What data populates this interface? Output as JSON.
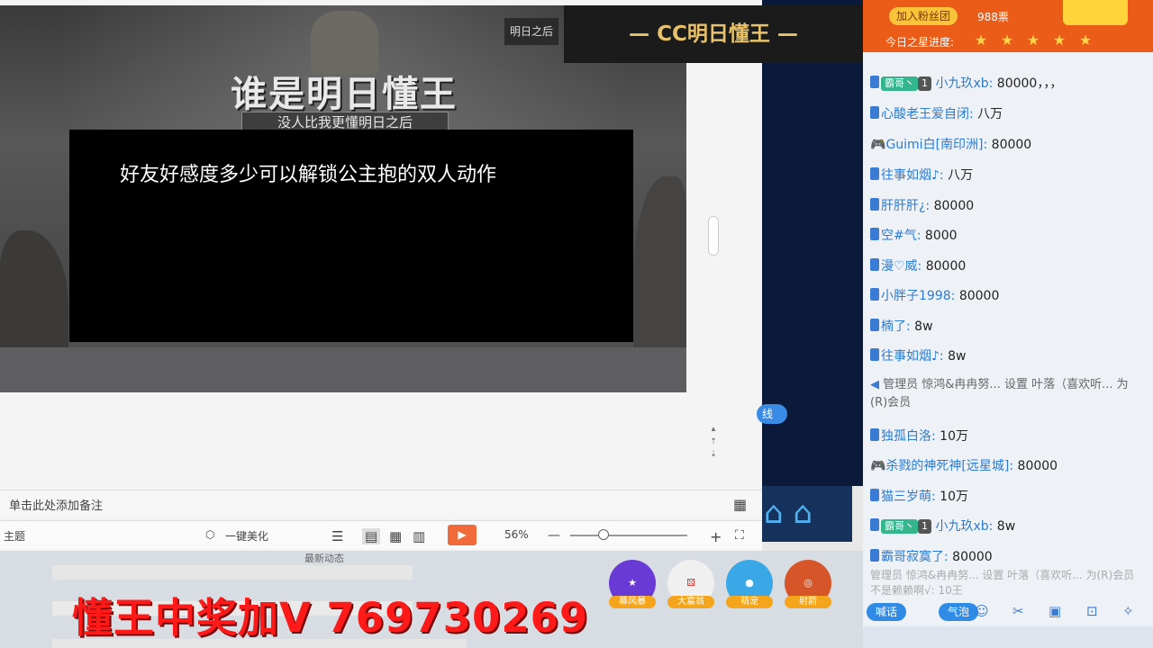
{
  "slide": {
    "logo": "明日之后",
    "title": "谁是明日懂王",
    "subtitle": "没人比我更懂明日之后",
    "question": "好友好感度多少可以解锁公主抱的双人动作"
  },
  "notes": {
    "placeholder": "单击此处添加备注"
  },
  "statusbar": {
    "theme": "主题",
    "beautify": "一键美化",
    "zoom": "56%"
  },
  "banner": {
    "text": "CC明日懂王"
  },
  "live_tag": "线",
  "feed": {
    "title": "最新动态",
    "promo": "懂王中奖加V 769730269"
  },
  "gifts": [
    {
      "label": "幕风暴"
    },
    {
      "label": "大富翁"
    },
    {
      "label": "萌宠"
    },
    {
      "label": "射箭"
    }
  ],
  "panel": {
    "join_fans": "加入粉丝团",
    "votes": "988票",
    "star_progress_label": "今日之星进度:",
    "stars": [
      "1",
      "2",
      "3",
      "4",
      "5"
    ]
  },
  "chat": [
    {
      "badge": "霸哥丶",
      "level": "1",
      "user": "小九玖xb:",
      "msg": "80000，，，"
    },
    {
      "badge": "",
      "level": "",
      "user": "心酸老王爱自闭:",
      "msg": "八万"
    },
    {
      "badge": "",
      "level": "",
      "user": "Guimi白[南印洲]:",
      "msg": "80000"
    },
    {
      "badge": "",
      "level": "",
      "user": "往事如烟♪:",
      "msg": "八万"
    },
    {
      "badge": "",
      "level": "",
      "user": "肝肝肝¿:",
      "msg": "80000"
    },
    {
      "badge": "",
      "level": "",
      "user": "空#气:",
      "msg": "8000"
    },
    {
      "badge": "",
      "level": "",
      "user": "漫♡威:",
      "msg": "80000"
    },
    {
      "badge": "",
      "level": "",
      "user": "小胖子1998:",
      "msg": "80000"
    },
    {
      "badge": "",
      "level": "",
      "user": "楠了:",
      "msg": "8w"
    },
    {
      "badge": "",
      "level": "",
      "user": "往事如烟♪:",
      "msg": "8w"
    }
  ],
  "system_msg": "管理员  惊鸿&冉冉努...  设置  叶落（喜欢听... 为(R)会员",
  "chat2": [
    {
      "badge": "",
      "level": "",
      "user": "独孤白洛:",
      "msg": "10万"
    },
    {
      "badge": "",
      "level": "",
      "user": "杀戮的神死神[远星城]:",
      "msg": "80000"
    },
    {
      "badge": "",
      "level": "",
      "user": "猫三岁萌:",
      "msg": "10万"
    },
    {
      "badge": "霸哥丶",
      "level": "1",
      "user": "小九玖xb:",
      "msg": "8w"
    },
    {
      "badge": "",
      "level": "",
      "user": "霸哥寂寞了:",
      "msg": "80000"
    }
  ],
  "gray_msg": "管理员 惊鸿&冉冉努... 设置 叶落（喜欢听... 为(R)会员  不是赖赖啊√: 10王",
  "tools": {
    "speak": "喊话",
    "bubble": "气泡"
  }
}
